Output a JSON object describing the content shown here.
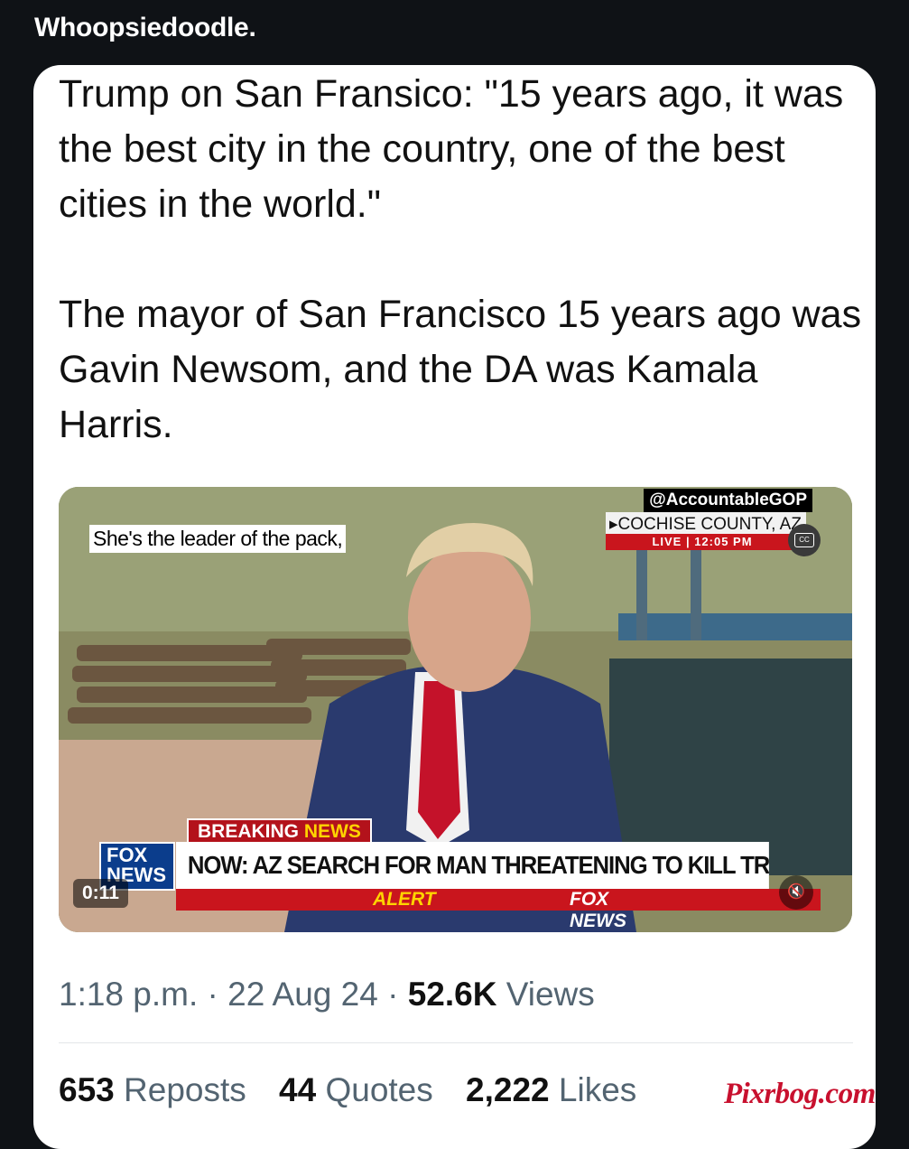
{
  "post": {
    "title": "Whoopsiedoodle."
  },
  "tweet": {
    "paragraph1": "Trump on San Fransico: \"15 years ago, it was the best city in the country, one of the best cities in the world.\"",
    "paragraph2": "The mayor of San Francisco 15 years ago was Gavin Newsom, and the DA was Kamala Harris.",
    "video": {
      "caption": "She's the leader of the pack,",
      "handle": "@AccountableGOP",
      "location": "▸COCHISE COUNTY, AZ",
      "live": "LIVE | 12:05 PM",
      "cc_label": "CC",
      "breaking_label": "BREAKING",
      "breaking_news_word": "NEWS",
      "fox_logo": "FOX NEWS",
      "headline": "NOW: AZ SEARCH FOR MAN THREATENING TO KILL TRUMP",
      "alert_fox": "FOX NEWS",
      "alert_word": "ALERT",
      "timestamp": "0:11",
      "mute_icon": "mute-icon"
    },
    "meta": {
      "time": "1:18 p.m.",
      "date": "22 Aug 24",
      "views_count": "52.6K",
      "views_label": "Views"
    },
    "stats": {
      "reposts_count": "653",
      "reposts_label": "Reposts",
      "quotes_count": "44",
      "quotes_label": "Quotes",
      "likes_count": "2,222",
      "likes_label": "Likes"
    }
  },
  "watermark": "Pixrbog.com",
  "colors": {
    "background": "#0f1216",
    "card": "#ffffff",
    "muted_text": "#536471",
    "fox_red": "#c9151d",
    "watermark": "#c8102e"
  }
}
